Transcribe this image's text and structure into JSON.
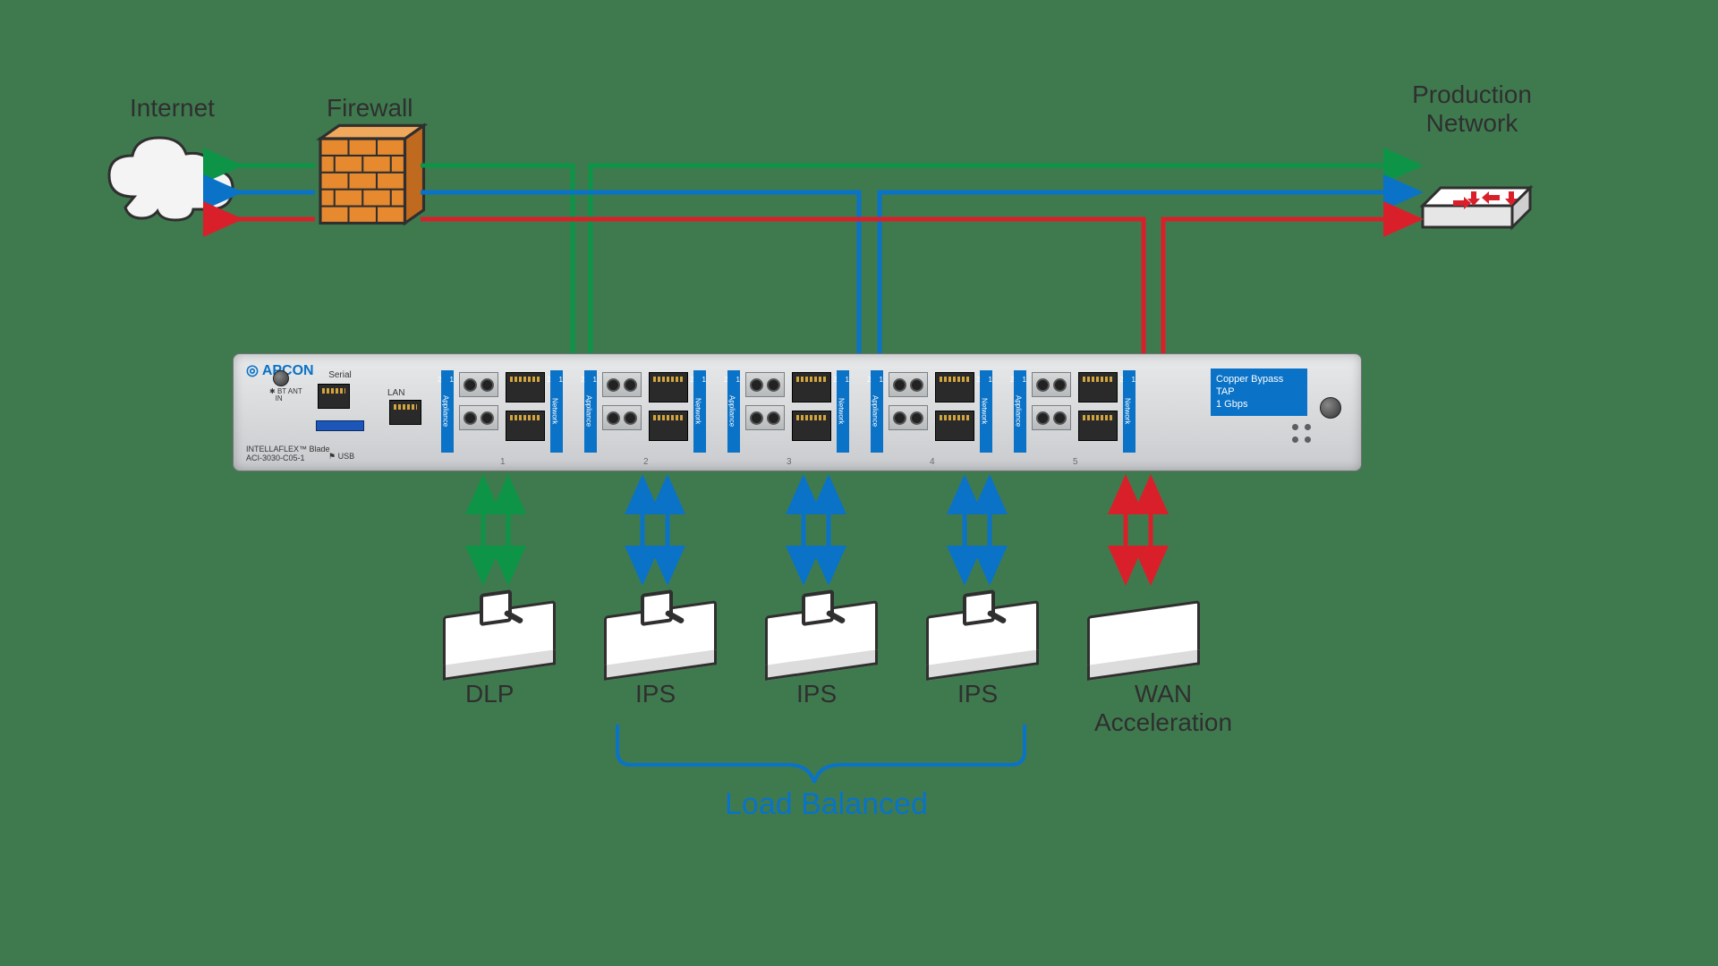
{
  "top_labels": {
    "internet": "Internet",
    "firewall": "Firewall",
    "prod_net_l1": "Production",
    "prod_net_l2": "Network"
  },
  "blade": {
    "brand": "APCON",
    "model_l1": "INTELLAFLEX™ Blade",
    "model_l2": "ACI-3030-C05-1",
    "serial": "Serial",
    "lan": "LAN",
    "usb": "USB",
    "bt_l1": "BT ANT",
    "bt_l2": "IN",
    "appliance": "Appliance",
    "network": "Network",
    "one": "1",
    "two": "2",
    "tap_l1": "Copper Bypass TAP",
    "tap_l2": "1 Gbps",
    "ports": [
      "1",
      "2",
      "3",
      "4",
      "5"
    ]
  },
  "appliances": {
    "dlp": "DLP",
    "ips": "IPS",
    "wan_l1": "WAN",
    "wan_l2": "Acceleration"
  },
  "load_balanced": "Load Balanced",
  "colors": {
    "green": "#0e9447",
    "blue": "#0a72c7",
    "red": "#d9202a",
    "brick": "#e78a2f"
  }
}
